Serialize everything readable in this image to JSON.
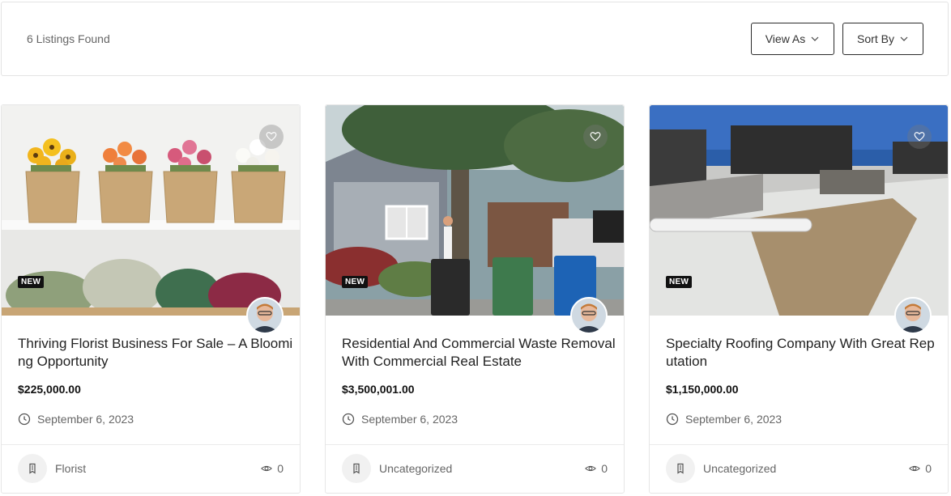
{
  "header": {
    "listings_count": "6 Listings Found",
    "view_as_label": "View As",
    "sort_by_label": "Sort By"
  },
  "listings": [
    {
      "badge": "NEW",
      "title": "Thriving Florist Business For Sale – A Blooming Opportunity",
      "price": "$225,000.00",
      "date": "September 6, 2023",
      "category": "Florist",
      "views": "0",
      "image": "flower-baskets-photo"
    },
    {
      "badge": "NEW",
      "title": "Residential And Commercial Waste Removal With Commercial Real Estate",
      "price": "$3,500,001.00",
      "date": "September 6, 2023",
      "category": "Uncategorized",
      "views": "0",
      "image": "trash-bins-street-photo"
    },
    {
      "badge": "NEW",
      "title": "Specialty Roofing Company With Great Reputation",
      "price": "$1,150,000.00",
      "date": "September 6, 2023",
      "category": "Uncategorized",
      "views": "0",
      "image": "rooftop-coating-photo"
    }
  ],
  "icons": {
    "favorite": "heart-icon",
    "date": "clock-icon",
    "category": "tag-icon",
    "views": "eye-icon",
    "dropdown": "chevron-down-icon"
  }
}
